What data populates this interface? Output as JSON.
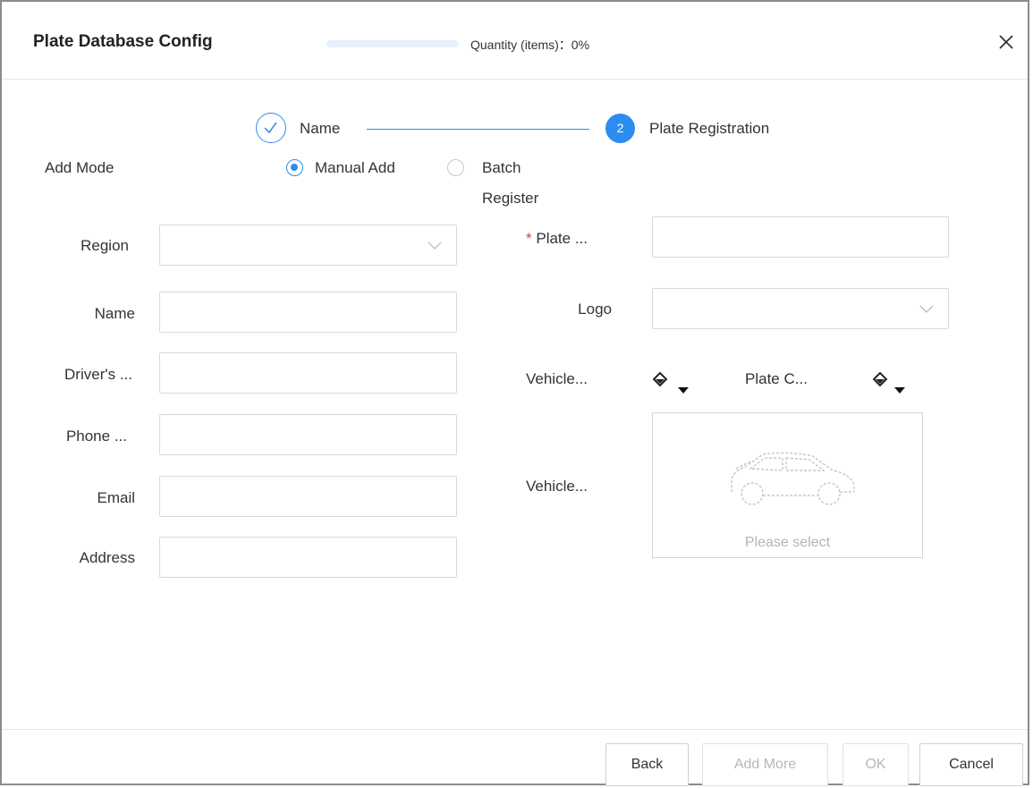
{
  "dialog": {
    "title": "Plate Database Config",
    "quantity_label": "Quantity (items)：0%",
    "quantity_progress": 0,
    "close_icon": "close-icon"
  },
  "steps": [
    {
      "label": "Name",
      "state": "done",
      "icon": "check-icon"
    },
    {
      "label": "Plate Registration",
      "state": "active",
      "number": "2"
    }
  ],
  "add_mode": {
    "label": "Add Mode",
    "options": [
      {
        "label": "Manual Add",
        "checked": true
      },
      {
        "label_line1": "Batch",
        "label_line2": "Register",
        "checked": false
      }
    ]
  },
  "left_form": {
    "region": {
      "label": "Region",
      "value": ""
    },
    "name": {
      "label": "Name",
      "value": ""
    },
    "driver": {
      "label": "Driver's ...",
      "value": ""
    },
    "phone": {
      "label": "Phone ...",
      "value": ""
    },
    "email": {
      "label": "Email",
      "value": ""
    },
    "address": {
      "label": "Address",
      "value": ""
    }
  },
  "right_form": {
    "plate": {
      "required_mark": "*",
      "label": "Plate ...",
      "value": ""
    },
    "logo": {
      "label": "Logo",
      "value": ""
    },
    "vehicle_color": {
      "label": "Vehicle...",
      "icon": "paint-bucket-icon"
    },
    "plate_color": {
      "label": "Plate C...",
      "icon": "paint-bucket-icon"
    },
    "vehicle_image": {
      "label": "Vehicle...",
      "hint": "Please select",
      "icon": "car-outline-icon"
    }
  },
  "footer": {
    "back": "Back",
    "add_more": "Add More",
    "ok": "OK",
    "cancel": "Cancel"
  },
  "colors": {
    "accent": "#2c8cf0",
    "required": "#e5393b",
    "border": "#d9d9d9"
  }
}
